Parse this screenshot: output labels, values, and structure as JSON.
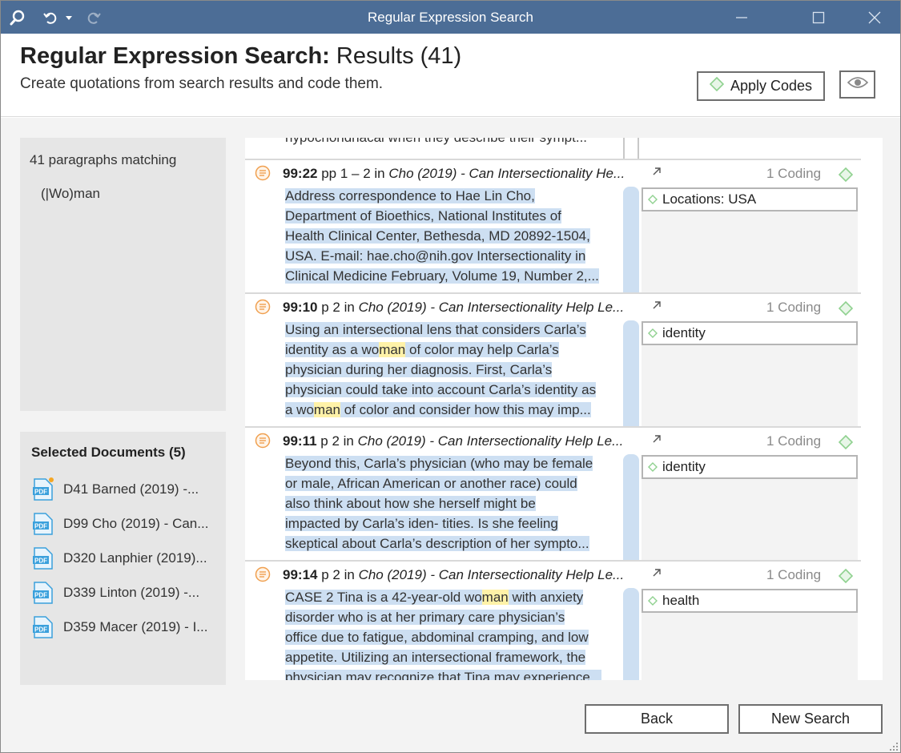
{
  "window": {
    "title": "Regular Expression Search"
  },
  "header": {
    "title_bold": "Regular Expression Search:",
    "title_rest": "Results (41)",
    "subtitle": "Create quotations from search results and code them.",
    "apply_codes_label": "Apply Codes"
  },
  "sidebar": {
    "matching": "41 paragraphs matching",
    "pattern": "(|Wo)man",
    "selected_docs_title": "Selected Documents (5)",
    "documents": [
      {
        "label": "D41 Barned (2019) -..."
      },
      {
        "label": "D99 Cho (2019) - Can..."
      },
      {
        "label": "D320 Lanphier (2019)..."
      },
      {
        "label": "D339 Linton (2019) -..."
      },
      {
        "label": "D359 Macer (2019) - I..."
      }
    ]
  },
  "results": {
    "top_stub": "hypochondriacal  when they describe their  sympt...",
    "items": [
      {
        "id": "99:22",
        "pages": "pp 1 – 2",
        "in": "in",
        "doc": "Cho (2019) - Can Intersectionality He...",
        "coding": "1 Coding",
        "code": "Locations: USA",
        "lines": [
          [
            "Address correspondence to Hae Lin Cho,"
          ],
          [
            "Department of Bioethics, National Institutes of"
          ],
          [
            "Health Clinical Center, Bethesda, MD  20892-1504,"
          ],
          [
            "USA. E-mail: hae.cho@nih.gov  Intersectionality in"
          ],
          [
            "Clinical Medicine  February, Volume 19, Number 2,..."
          ]
        ]
      },
      {
        "id": "99:10",
        "pages": "p 2",
        "in": "in",
        "doc": "Cho (2019) - Can Intersectionality Help Le...",
        "coding": "1 Coding",
        "code": "identity",
        "lines": [
          [
            "Using an intersectional lens that considers Carla’s"
          ],
          [
            "identity as a wo",
            "man",
            " of color may help Carla’s"
          ],
          [
            "physician  during her diagnosis. First, Carla’s"
          ],
          [
            "physician could take  into account Carla’s identity as"
          ],
          [
            "a wo",
            "man",
            " of color and  consider how this may imp..."
          ]
        ]
      },
      {
        "id": "99:11",
        "pages": "p 2",
        "in": "in",
        "doc": "Cho (2019) - Can Intersectionality Help Le...",
        "coding": "1 Coding",
        "code": "identity",
        "lines": [
          [
            "Beyond this, Carla’s physician (who may be female"
          ],
          [
            "or  male, African American or another race) could"
          ],
          [
            "also think  about how she herself might be"
          ],
          [
            "impacted by Carla’s iden-  tities. Is she feeling"
          ],
          [
            "skeptical about Carla’s description of  her sympto..."
          ]
        ]
      },
      {
        "id": "99:14",
        "pages": "p 2",
        "in": "in",
        "doc": "Cho (2019) - Can Intersectionality Help Le...",
        "coding": "1 Coding",
        "code": "health",
        "lines": [
          [
            "CASE 2  Tina is a 42-year-old wo",
            "man",
            " with anxiety"
          ],
          [
            "disorder who  is at her primary care physician’s"
          ],
          [
            "office due to fatigue,  abdominal cramping, and low"
          ],
          [
            "appetite. Utilizing an  intersectional framework, the"
          ],
          [
            "physician may recognize  that Tina may experience..."
          ]
        ]
      }
    ]
  },
  "footer": {
    "back_label": "Back",
    "new_search_label": "New Search"
  },
  "colors": {
    "titlebar": "#4c6d96",
    "selection": "#cddff2",
    "match_highlight": "#fff2a8",
    "code_diamond": "#8fd18f",
    "quote_icon": "#f0a050",
    "pdf_icon": "#3aa0dc"
  }
}
